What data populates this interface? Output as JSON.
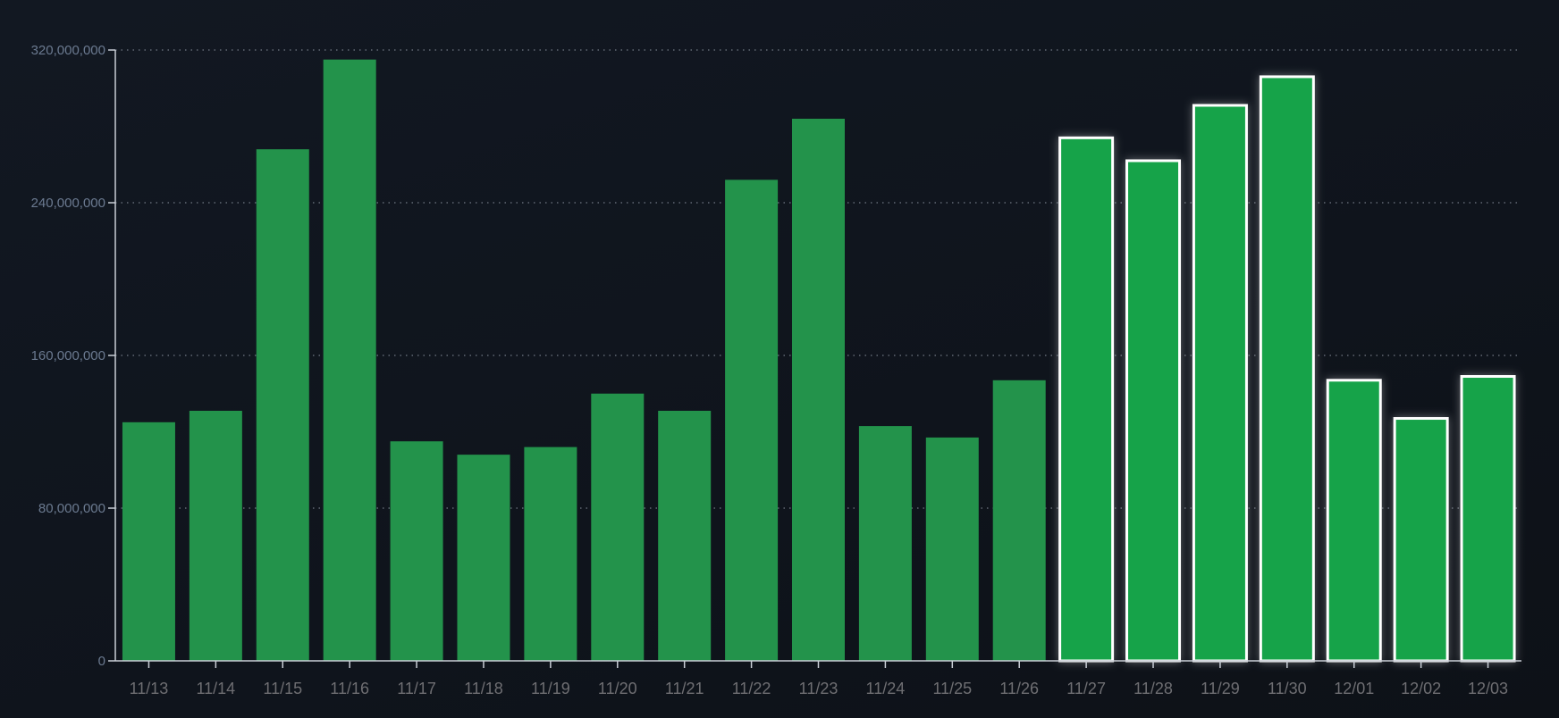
{
  "chart_data": {
    "type": "bar",
    "title": "",
    "xlabel": "",
    "ylabel": "",
    "ylim": [
      0,
      320000000
    ],
    "grid": true,
    "yticks": [
      0,
      80000000,
      160000000,
      240000000,
      320000000
    ],
    "ytick_labels": [
      "0",
      "80,000,000",
      "160,000,000",
      "240,000,000",
      "320,000,000"
    ],
    "categories": [
      "11/13",
      "11/14",
      "11/15",
      "11/16",
      "11/17",
      "11/18",
      "11/19",
      "11/20",
      "11/21",
      "11/22",
      "11/23",
      "11/24",
      "11/25",
      "11/26",
      "11/27",
      "11/28",
      "11/29",
      "11/30",
      "12/01",
      "12/02",
      "12/03"
    ],
    "values": [
      125000000,
      131000000,
      268000000,
      315000000,
      115000000,
      108000000,
      112000000,
      140000000,
      131000000,
      252000000,
      284000000,
      123000000,
      117000000,
      147000000,
      274000000,
      262000000,
      291000000,
      306000000,
      147000000,
      127000000,
      149000000
    ],
    "highlighted": [
      false,
      false,
      false,
      false,
      false,
      false,
      false,
      false,
      false,
      false,
      false,
      false,
      false,
      false,
      true,
      true,
      true,
      true,
      true,
      true,
      true
    ],
    "colors": {
      "bar": "#23934b",
      "highlight": "#16a34a",
      "highlight_stroke": "#ffffff",
      "axis": "#c9ced6",
      "grid": "#8b93a0",
      "ytick_text": "#6b7a90",
      "xtick_text": "#6e6e72"
    }
  }
}
